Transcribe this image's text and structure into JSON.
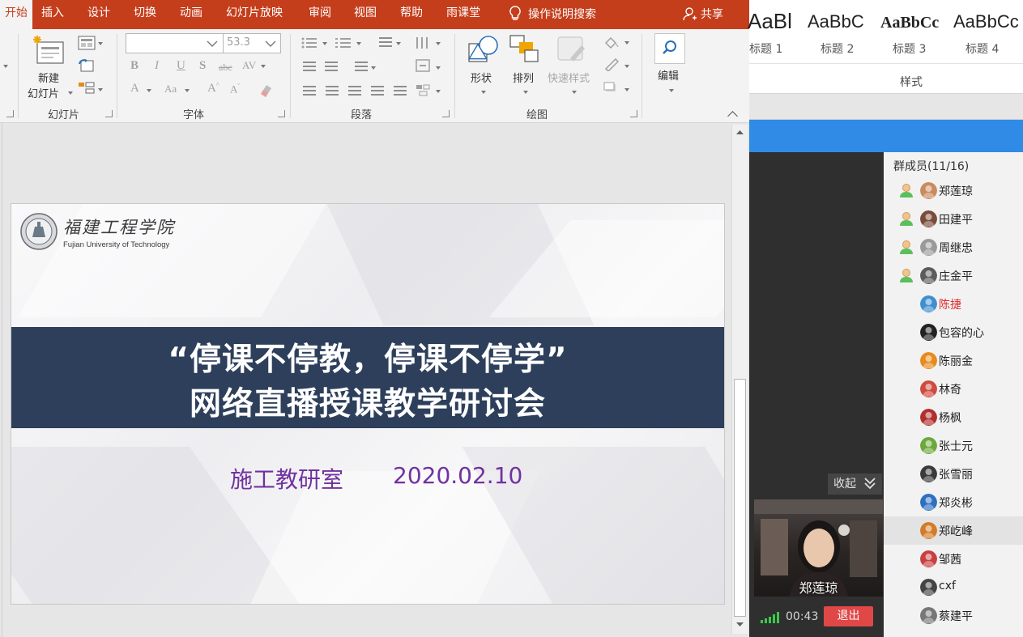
{
  "ppt": {
    "tabs": [
      {
        "label": "开始",
        "active": true
      },
      {
        "label": "插入"
      },
      {
        "label": "设计"
      },
      {
        "label": "切换"
      },
      {
        "label": "动画"
      },
      {
        "label": "幻灯片放映"
      },
      {
        "label": "审阅"
      },
      {
        "label": "视图"
      },
      {
        "label": "帮助"
      },
      {
        "label": "雨课堂"
      }
    ],
    "tell_me": "操作说明搜索",
    "share": "共享",
    "ribbon": {
      "new_slide_line1": "新建",
      "new_slide_line2": "幻灯片",
      "groups": {
        "slides": "幻灯片",
        "font": "字体",
        "paragraph": "段落",
        "drawing": "绘图"
      },
      "font_name_value": "",
      "font_size_value": "53.3",
      "shape_btn": "形状",
      "arrange_btn": "排列",
      "quick_styles_btn": "快速样式",
      "edit_btn": "编辑"
    }
  },
  "word": {
    "styles": [
      {
        "sample": "AaBl",
        "name": "标题 1"
      },
      {
        "sample": "AaBbC",
        "name": "标题 2"
      },
      {
        "sample": "AaBbCc",
        "name": "标题 3"
      },
      {
        "sample": "AaBbCc",
        "name": "标题 4"
      }
    ],
    "group_label": "样式"
  },
  "slide": {
    "logo_cn": "福建工程学院",
    "logo_en": "Fujian University of Technology",
    "title_line1": "“停课不停教，停课不停学”",
    "title_line2": "网络直播授课教学研讨会",
    "dept": "施工教研室",
    "date": "2020.02.10",
    "colors": {
      "band": "#2d3f5b",
      "subtitle": "#7132a0"
    }
  },
  "live": {
    "collapse": "收起",
    "video_name": "郑莲琼",
    "timer": "00:43",
    "exit": "退出",
    "members_title": "群成员(11/16)",
    "members": [
      {
        "name": "郑莲琼",
        "role": true,
        "avatar": "#c98b5e"
      },
      {
        "name": "田建平",
        "role": true,
        "avatar": "#7a4c3a"
      },
      {
        "name": "周继忠",
        "role": true,
        "avatar": "#9a9a9a"
      },
      {
        "name": "庄金平",
        "role": true,
        "avatar": "#5c5c5c"
      },
      {
        "name": "陈捷",
        "role": false,
        "avatar": "#3f8fd0",
        "red": true
      },
      {
        "name": "包容的心",
        "role": false,
        "avatar": "#222222"
      },
      {
        "name": "陈丽金",
        "role": false,
        "avatar": "#e88a1e"
      },
      {
        "name": "林奇",
        "role": false,
        "avatar": "#cf4b3f"
      },
      {
        "name": "杨枫",
        "role": false,
        "avatar": "#b12f2f"
      },
      {
        "name": "张士元",
        "role": false,
        "avatar": "#6da83c"
      },
      {
        "name": "张雪丽",
        "role": false,
        "avatar": "#3a3a3a"
      },
      {
        "name": "郑炎彬",
        "role": false,
        "avatar": "#2e70c0"
      },
      {
        "name": "郑屹峰",
        "role": false,
        "avatar": "#d37b28",
        "selected": true
      },
      {
        "name": "邹茜",
        "role": false,
        "avatar": "#c84040"
      },
      {
        "name": "cxf",
        "role": false,
        "avatar": "#444444"
      },
      {
        "name": "蔡建平",
        "role": false,
        "avatar": "#777777"
      }
    ]
  }
}
